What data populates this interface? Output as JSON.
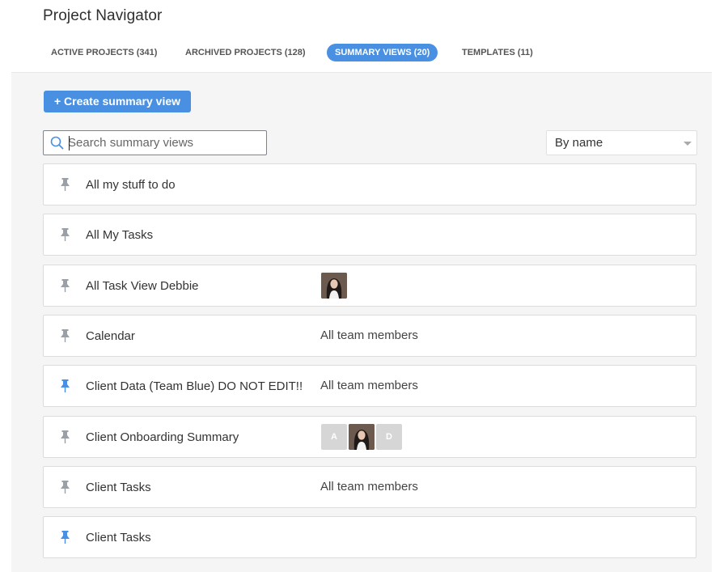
{
  "app": {
    "title": "Project Navigator"
  },
  "tabs": [
    {
      "label": "ACTIVE PROJECTS (341)",
      "active": false
    },
    {
      "label": "ARCHIVED PROJECTS (128)",
      "active": false
    },
    {
      "label": "SUMMARY VIEWS (20)",
      "active": true
    },
    {
      "label": "TEMPLATES (11)",
      "active": false
    }
  ],
  "toolbar": {
    "create_label": "+ Create summary view"
  },
  "search": {
    "placeholder": "Search summary views",
    "value": ""
  },
  "sort": {
    "selected": "By name"
  },
  "colors": {
    "accent": "#4a90e2",
    "pin_default": "#9aa0a6",
    "pin_active": "#4a90e2"
  },
  "views": [
    {
      "name": "All my stuff to do",
      "pinned": false,
      "shared_with": ""
    },
    {
      "name": "All My Tasks",
      "pinned": false,
      "shared_with": ""
    },
    {
      "name": "All Task View Debbie",
      "pinned": false,
      "shared_with": "",
      "avatars": [
        {
          "kind": "photo"
        }
      ]
    },
    {
      "name": "Calendar",
      "pinned": false,
      "shared_with": "All team members"
    },
    {
      "name": "Client Data (Team Blue) DO NOT EDIT!!",
      "pinned": true,
      "shared_with": "All team members"
    },
    {
      "name": "Client Onboarding Summary",
      "pinned": false,
      "shared_with": "",
      "avatars": [
        {
          "kind": "letter",
          "label": "A"
        },
        {
          "kind": "photo"
        },
        {
          "kind": "letter",
          "label": "D"
        }
      ]
    },
    {
      "name": "Client Tasks",
      "pinned": false,
      "shared_with": "All team members"
    },
    {
      "name": "Client Tasks",
      "pinned": true,
      "shared_with": ""
    }
  ]
}
